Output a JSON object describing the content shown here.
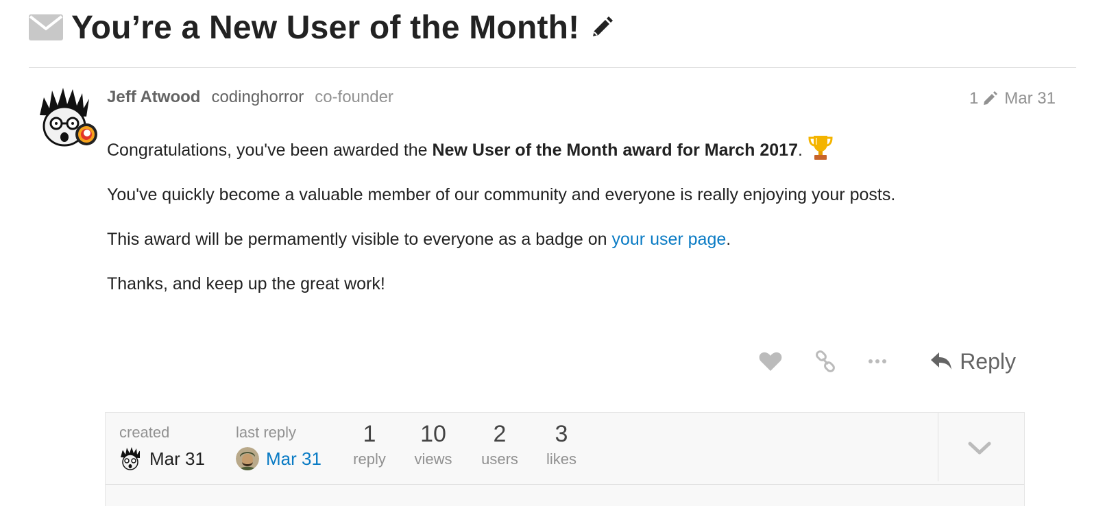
{
  "topic": {
    "title": "You’re a New User of the Month!"
  },
  "post": {
    "author_name": "Jeff Atwood",
    "author_username": "codinghorror",
    "author_title": "co-founder",
    "edit_count": "1",
    "date": "Mar 31",
    "body": {
      "p1_prefix": "Congratulations, you've been awarded the ",
      "p1_bold": "New User of the Month award for March 2017",
      "p1_suffix": ".",
      "p2": "You've quickly become a valuable member of our community and everyone is really enjoying your posts.",
      "p3_prefix": "This award will be permamently visible to everyone as a badge on ",
      "p3_link": "your user page",
      "p3_suffix": ".",
      "p4": "Thanks, and keep up the great work!"
    },
    "actions": {
      "reply_label": "Reply"
    }
  },
  "topic_map": {
    "created_label": "created",
    "created_date": "Mar 31",
    "last_reply_label": "last reply",
    "last_reply_date": "Mar 31",
    "replies_count": "1",
    "replies_label": "reply",
    "views_count": "10",
    "views_label": "views",
    "users_count": "2",
    "users_label": "users",
    "likes_count": "3",
    "likes_label": "likes"
  },
  "icons": {
    "title_icon": "envelope-icon",
    "edit_title": "pencil-icon",
    "edit_history": "pencil-icon",
    "award": "trophy-icon",
    "like": "heart-icon",
    "share": "link-icon",
    "more": "ellipsis-icon",
    "reply": "reply-arrow-icon",
    "expand": "chevron-down-icon"
  },
  "colors": {
    "link": "#0a7bc4",
    "muted": "#919191",
    "icon": "#bbbbbb"
  }
}
